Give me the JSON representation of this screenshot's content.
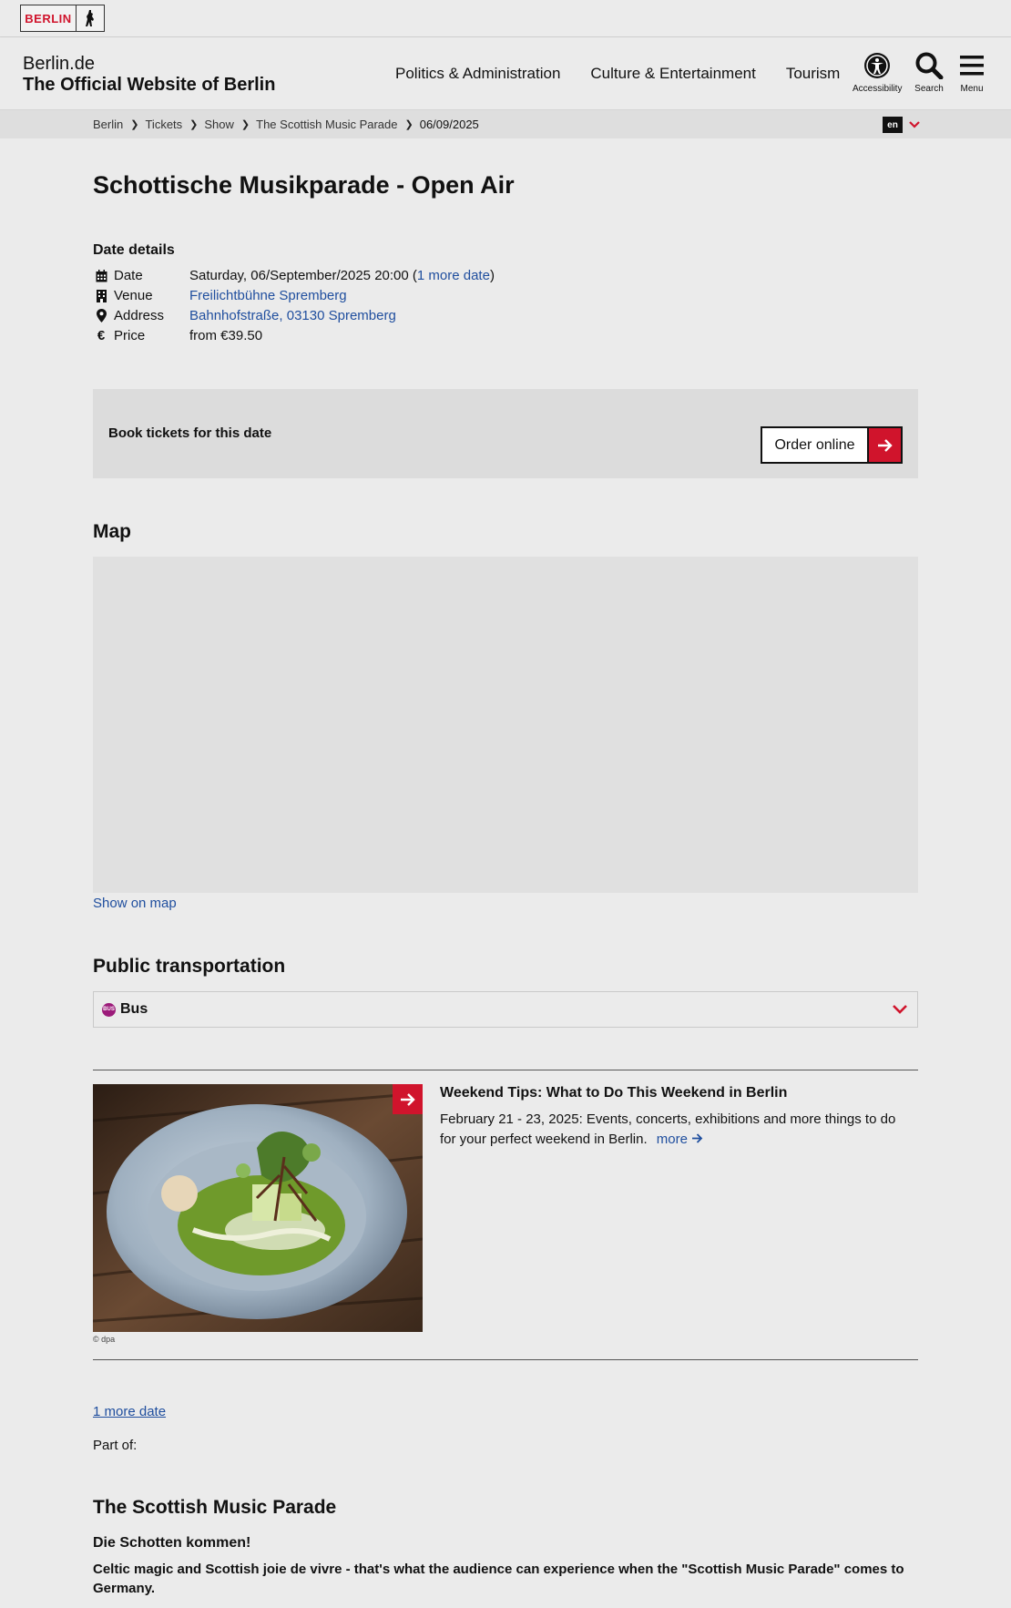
{
  "logo": {
    "text": "BERLIN"
  },
  "header": {
    "site_name": "Berlin.de",
    "site_subtitle": "The Official Website of Berlin",
    "nav": [
      "Politics & Administration",
      "Culture & Entertainment",
      "Tourism"
    ],
    "tools": {
      "accessibility": "Accessibility",
      "search": "Search",
      "menu": "Menu"
    }
  },
  "breadcrumb": [
    "Berlin",
    "Tickets",
    "Show",
    "The Scottish Music Parade",
    "06/09/2025"
  ],
  "language": "en",
  "page_title": "Schottische Musikparade - Open Air",
  "date_details": {
    "heading": "Date details",
    "date_label": "Date",
    "date_value": "Saturday, 06/September/2025 20:00 (",
    "more_date_link": "1 more date",
    "date_close": ")",
    "venue_label": "Venue",
    "venue_value": "Freilichtbühne Spremberg",
    "address_label": "Address",
    "address_value": "Bahnhofstraße, 03130 Spremberg",
    "price_label": "Price",
    "price_value": "from €39.50"
  },
  "booking": {
    "text": "Book tickets for this date",
    "button": "Order online"
  },
  "map": {
    "heading": "Map",
    "link": "Show on map"
  },
  "transport": {
    "heading": "Public transportation",
    "bus_icon": "BUS",
    "bus_label": "Bus"
  },
  "teaser": {
    "title": "Weekend Tips: What to Do This Weekend in Berlin",
    "text": "February 21 - 23, 2025: Events, concerts, exhibitions and more things to do for your perfect weekend in Berlin.",
    "more": "more",
    "credit": "© dpa"
  },
  "more_dates_link": "1 more date",
  "part_of": "Part of:",
  "series": {
    "title": "The Scottish Music Parade",
    "subtitle": "Die Schotten kommen!",
    "lead": "Celtic magic and Scottish joie de vivre - that's what the audience can experience when the \"Scottish Music Parade\" comes to Germany."
  },
  "colors": {
    "accent": "#d0142c",
    "link": "#1f4e9e",
    "background": "#ebebeb"
  }
}
